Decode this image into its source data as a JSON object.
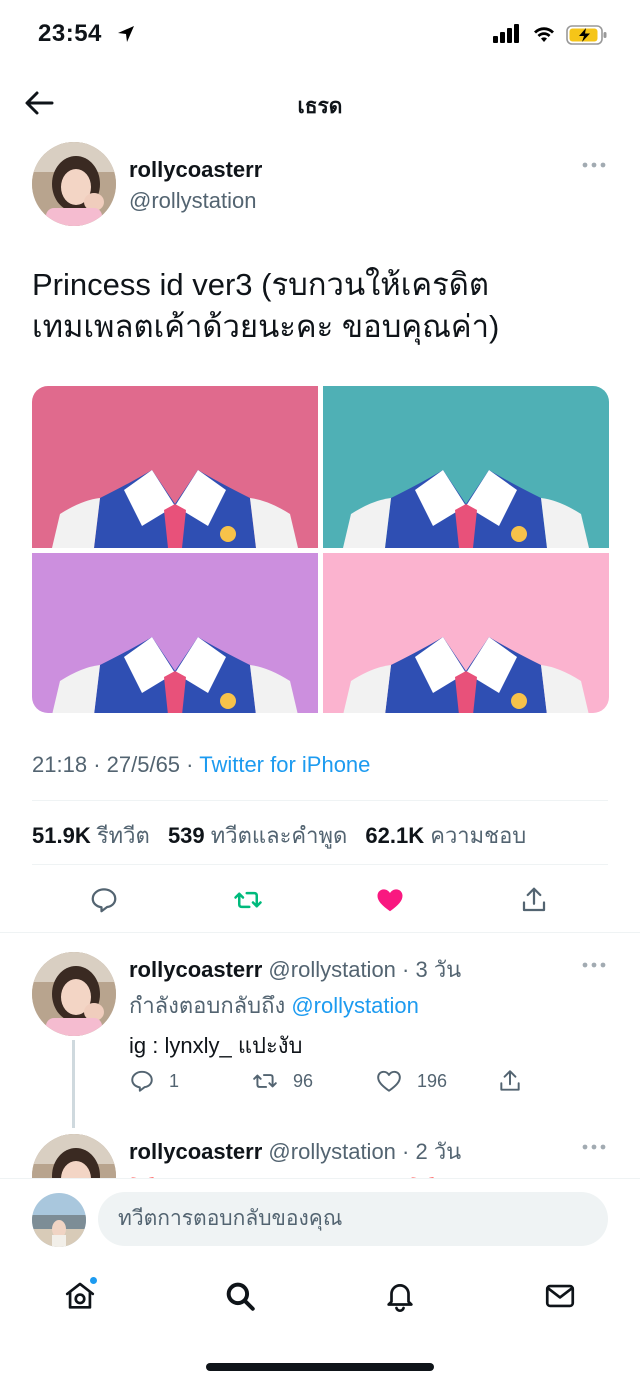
{
  "status_bar": {
    "time": "23:54"
  },
  "header": {
    "title": "เธรด"
  },
  "tweet": {
    "author_name": "rollycoasterr",
    "author_handle": "@rollystation",
    "text_line1": "Princess id ver3 (รบกวนให้เครดิต",
    "text_line2": "เทมเพลตเค้าด้วยนะคะ ขอบคุณค่า)",
    "media_colors": [
      "#e06a8d",
      "#4fb0b5",
      "#cc8fde",
      "#fbb3cf"
    ],
    "time": "21:18",
    "date": "27/5/65",
    "source": "Twitter for iPhone",
    "stats": {
      "retweets_count": "51.9K",
      "retweets_label": "รีทวีต",
      "quotes_count": "539",
      "quotes_label": "ทวีตและคำพูด",
      "likes_count": "62.1K",
      "likes_label": "ความชอบ"
    }
  },
  "colors": {
    "accent": "#1d9bf0",
    "retweet": "#00ba7c",
    "like": "#f91880",
    "muted": "#536471"
  },
  "replies": [
    {
      "name": "rollycoasterr",
      "handle": "@rollystation",
      "age": "· 3 วัน",
      "reply_to_prefix": "กำลังตอบกลับถึง",
      "reply_to_handle": "@rollystation",
      "text": "ig : lynxly_ แปะงับ",
      "replies_count": "1",
      "retweets_count": "96",
      "likes_count": "196"
    },
    {
      "name": "rollycoasterr",
      "handle": "@rollystation",
      "age": "· 2 วัน",
      "text": "🎀รวมชุด+ครอบแบบ png ค่า🎀"
    }
  ],
  "compose": {
    "placeholder": "ทวีตการตอบกลับของคุณ"
  },
  "tab_bar": {
    "icons": [
      "home-icon",
      "search-icon",
      "bell-icon",
      "mail-icon"
    ]
  }
}
